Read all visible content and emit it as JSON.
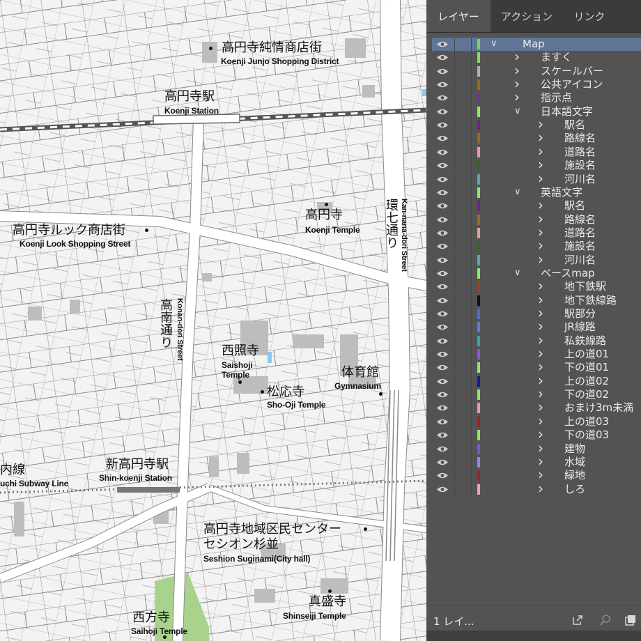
{
  "map": {
    "labels": {
      "junjo_jp": "高円寺純情商店街",
      "junjo_en": "Koenji Junjo Shopping District",
      "koenji_station_jp": "高円寺駅",
      "koenji_station_en": "Koenji Station",
      "look_jp": "高円寺ルック商店街",
      "look_en": "Koenji Look Shopping Street",
      "koenji_temple_jp": "高円寺",
      "koenji_temple_en": "Koenji Temple",
      "kannana_jp": "環七通り",
      "kannana_en": "Kan-nana-dori Street",
      "konan_jp": "高南通り",
      "konan_en": "Konan-dori Street",
      "saishoji_jp": "西照寺",
      "saishoji_en": "Saishoji Temple",
      "shooji_jp": "松応寺",
      "shooji_en": "Sho-Oji Temple",
      "gym_jp": "体育館",
      "gym_en": "Gymnasium",
      "subway_jp": "内線",
      "subway_en": "uchi Subway Line",
      "shinkoenji_jp": "新高円寺駅",
      "shinkoenji_en": "Shin-koenji Station",
      "center_jp1": "高円寺地域区民センター",
      "center_jp2": "セシオン杉並",
      "center_en": "Seshion Suginami(City hall)",
      "shinseiji_jp": "真盛寺",
      "shinseiji_en": "Shinseiji Temple",
      "saihoji_jp": "西方寺",
      "saihoji_en": "Saihoji Temple"
    }
  },
  "panel": {
    "tabs": [
      "レイヤー",
      "アクション",
      "リンク"
    ],
    "layers": [
      {
        "name": "Map",
        "depth": 0,
        "expanded": true,
        "color": "#79d35a",
        "selected": true
      },
      {
        "name": "ますく",
        "depth": 1,
        "expanded": false,
        "color": "#7ee05d"
      },
      {
        "name": "スケールバー",
        "depth": 1,
        "expanded": false,
        "color": "#b0b0b0"
      },
      {
        "name": "公共アイコン",
        "depth": 1,
        "expanded": false,
        "color": "#9a6a14"
      },
      {
        "name": "指示点",
        "depth": 1,
        "expanded": false,
        "color": "#7a2f8e"
      },
      {
        "name": "日本語文字",
        "depth": 1,
        "expanded": true,
        "color": "#8fe860"
      },
      {
        "name": "駅名",
        "depth": 2,
        "expanded": false,
        "color": "#7a1f7e"
      },
      {
        "name": "路線名",
        "depth": 2,
        "expanded": false,
        "color": "#a0661e"
      },
      {
        "name": "道路名",
        "depth": 2,
        "expanded": false,
        "color": "#e69aa8"
      },
      {
        "name": "施設名",
        "depth": 2,
        "expanded": false,
        "color": "#2f6a1e"
      },
      {
        "name": "河川名",
        "depth": 2,
        "expanded": false,
        "color": "#5aa5a5"
      },
      {
        "name": "英語文字",
        "depth": 1,
        "expanded": true,
        "color": "#8fe860"
      },
      {
        "name": "駅名",
        "depth": 2,
        "expanded": false,
        "color": "#7a1f7e"
      },
      {
        "name": "路線名",
        "depth": 2,
        "expanded": false,
        "color": "#a0661e"
      },
      {
        "name": "道路名",
        "depth": 2,
        "expanded": false,
        "color": "#e69aa8"
      },
      {
        "name": "施設名",
        "depth": 2,
        "expanded": false,
        "color": "#2f6a1e"
      },
      {
        "name": "河川名",
        "depth": 2,
        "expanded": false,
        "color": "#5aa5a5"
      },
      {
        "name": "ベースmap",
        "depth": 1,
        "expanded": true,
        "color": "#8fe860"
      },
      {
        "name": "地下鉄駅",
        "depth": 2,
        "expanded": false,
        "color": "#a83a1e"
      },
      {
        "name": "地下鉄線路",
        "depth": 2,
        "expanded": false,
        "color": "#111111"
      },
      {
        "name": "駅部分",
        "depth": 2,
        "expanded": false,
        "color": "#4f6ad6"
      },
      {
        "name": "JR線路",
        "depth": 2,
        "expanded": false,
        "color": "#5a7ae0"
      },
      {
        "name": "私鉄線路",
        "depth": 2,
        "expanded": false,
        "color": "#3aa5a5"
      },
      {
        "name": "上の道01",
        "depth": 2,
        "expanded": false,
        "color": "#9b4fe0"
      },
      {
        "name": "下の道01",
        "depth": 2,
        "expanded": false,
        "color": "#8fe860"
      },
      {
        "name": "上の道02",
        "depth": 2,
        "expanded": false,
        "color": "#1a1a9a"
      },
      {
        "name": "下の道02",
        "depth": 2,
        "expanded": false,
        "color": "#8fe860"
      },
      {
        "name": "おまけ3m未満",
        "depth": 2,
        "expanded": false,
        "color": "#e69aa8"
      },
      {
        "name": "上の道03",
        "depth": 2,
        "expanded": false,
        "color": "#a51e1e"
      },
      {
        "name": "下の道03",
        "depth": 2,
        "expanded": false,
        "color": "#8fe860"
      },
      {
        "name": "建物",
        "depth": 2,
        "expanded": false,
        "color": "#6a5ae0"
      },
      {
        "name": "水域",
        "depth": 2,
        "expanded": false,
        "color": "#8a8af0"
      },
      {
        "name": "緑地",
        "depth": 2,
        "expanded": false,
        "color": "#a51e3a"
      },
      {
        "name": "しろ",
        "depth": 2,
        "expanded": false,
        "color": "#f0a0b0"
      }
    ],
    "footer": {
      "label": "1 レイ..."
    }
  }
}
